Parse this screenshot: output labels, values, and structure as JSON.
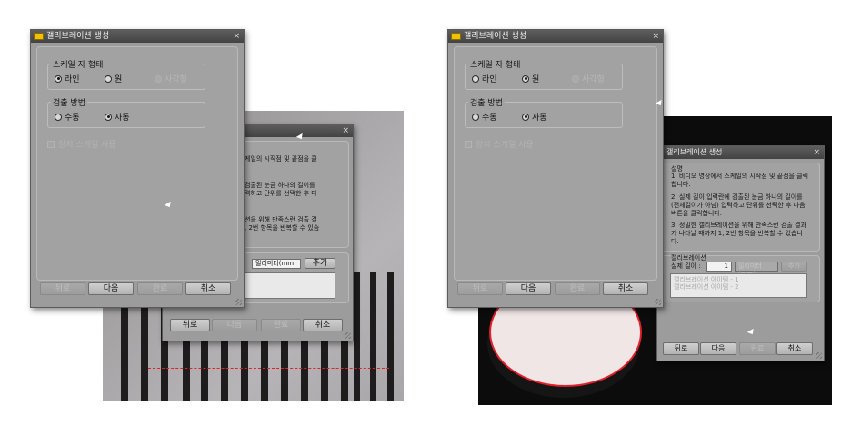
{
  "dialog": {
    "title": "갤리브레이션 생성",
    "close_glyph": "×",
    "scale_shape": {
      "label": "스케일 자 형태",
      "options": [
        "라인",
        "원",
        "사각형"
      ],
      "selected": "라인",
      "selected_right": "원"
    },
    "detect_method": {
      "label": "검출 방법",
      "options": [
        "수동",
        "자동"
      ],
      "selected": "자동"
    },
    "device_scale_label": "장치 스케일 사용",
    "buttons": {
      "back": "뒤로",
      "next": "다음",
      "finish": "완료",
      "cancel": "취소"
    }
  },
  "left_back_dialog": {
    "close_glyph": "×",
    "text_line1": "케일의 시작점 및 끝점을 클",
    "text_line2a": "검출된 눈금 하나의 길이를",
    "text_line2b": "력하고 단위를 선택한 후 다",
    "text_line3a": "션을 위해 만족스런 검출 결",
    "text_line3b": ", 2번 항목을 반복할 수 있슴",
    "unit_value": "밀리미터(mm",
    "add_button": "추가",
    "buttons": {
      "back": "뒤로",
      "next": "다음",
      "finish": "완료",
      "cancel": "취소"
    }
  },
  "right_back_dialog": {
    "title": "갤리브레이션 생성",
    "close_glyph": "×",
    "desc_label": "설명",
    "steps": [
      "1. 비디오 영상에서 스케일의 시작점 및 끝점을 클릭합니다.",
      "2. 실제 길이 입력란에 검출된 눈금 하나의 길이를 (전체길이가 아님) 입력하고 단위를 선택한 후 다음 버튼을 클릭합니다.",
      "3. 정밀한 캘리브레이션을 위해 만족스런 검출 결과가 나타날 때까지 1, 2번 항목을 반복할 수 있습니다."
    ],
    "calib_label": "캘리브레이션",
    "length_label": "실제 길이 :",
    "length_value": "1",
    "unit_value": "밀리미터(mm)",
    "add_button": "추가",
    "list_items": [
      "캘리브레이션 아이템 - 1",
      "캘리브레이션 아이템 - 2"
    ],
    "buttons": {
      "back": "뒤로",
      "next": "다음",
      "finish": "완료",
      "cancel": "취소"
    }
  },
  "colors": {
    "window_bg": "#9c9c9c",
    "titlebar": "#4a4a4a",
    "app_icon": "#f2c200",
    "measure_line": "#e0202a"
  }
}
